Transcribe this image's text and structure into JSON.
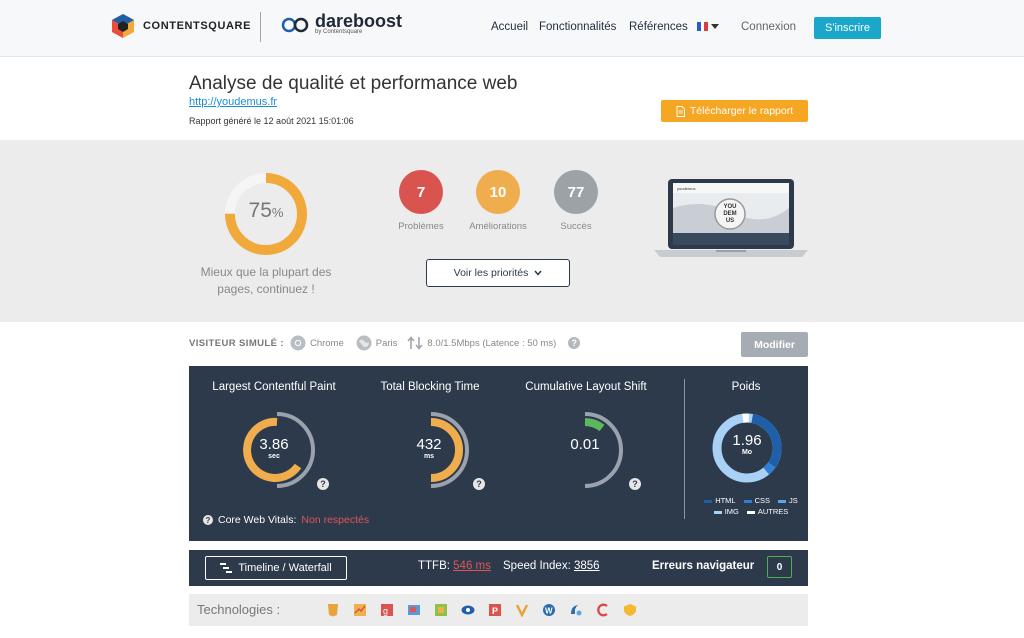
{
  "header": {
    "brand_primary": "CONTENTSQUARE",
    "brand_secondary": "dareboost",
    "brand_secondary_sub": "by Contentsquare",
    "nav": [
      "Accueil",
      "Fonctionnalités",
      "Références"
    ],
    "language": "FR",
    "login": "Connexion",
    "signup": "S'inscrire"
  },
  "report": {
    "title": "Analyse de qualité et performance web",
    "url": "http://youdemus.fr",
    "date": "Rapport généré le 12 août 2021 15:01:06",
    "download": "Télécharger le rapport"
  },
  "summary": {
    "score": "75",
    "score_unit": "%",
    "score_fraction": 0.75,
    "message": "Mieux que la plupart des pages, continuez !",
    "problems": {
      "count": "7",
      "label": "Problèmes",
      "color": "#d9534f"
    },
    "improvements": {
      "count": "10",
      "label": "Améliorations",
      "color": "#f0ad4e"
    },
    "successes": {
      "count": "77",
      "label": "Succès",
      "color": "#9ba3a8"
    },
    "priorities_button": "Voir les priorités",
    "preview_text": "YOU DEM US",
    "preview_site_name": "youdemus"
  },
  "visitor": {
    "label": "VISITEUR SIMULÉ :",
    "browser": "Chrome",
    "location": "Paris",
    "connection": "8.0/1.5Mbps (Latence : 50 ms)",
    "modify": "Modifier"
  },
  "metrics": {
    "lcp": {
      "label": "Largest Contentful Paint",
      "value": "3.86",
      "unit": "sec",
      "color": "#f0ad4e"
    },
    "tbt": {
      "label": "Total Blocking Time",
      "value": "432",
      "unit": "ms",
      "color": "#f0ad4e"
    },
    "cls": {
      "label": "Cumulative Layout Shift",
      "value": "0.01",
      "unit": "",
      "color": "#5cb85c"
    },
    "weight": {
      "label": "Poids",
      "value": "1.96",
      "unit": "Mo"
    },
    "core_web_vitals_label": "Core Web Vitals:",
    "core_web_vitals_status": "Non respectés",
    "legend": [
      "HTML",
      "CSS",
      "JS",
      "IMG",
      "AUTRES"
    ],
    "legend_colors": {
      "HTML": "#1f5fa8",
      "CSS": "#2f7fd6",
      "JS": "#5aa5ee",
      "IMG": "#a8d1f5",
      "AUTRES": "#ffffff"
    }
  },
  "timeline": {
    "button": "Timeline / Waterfall",
    "ttfb_label": "TTFB:",
    "ttfb_value": "546 ms",
    "speed_label": "Speed Index:",
    "speed_value": "3856",
    "errors_label": "Erreurs navigateur",
    "errors_value": "0"
  },
  "technologies": {
    "label": "Technologies :",
    "icons": [
      "html5-icon",
      "chart-icon",
      "magento-like-icon",
      "mixed-icon",
      "grid-icon",
      "eye-icon",
      "p-icon",
      "v-icon",
      "wordpress-icon",
      "cdn-icon",
      "c-icon",
      "shield-icon"
    ]
  }
}
